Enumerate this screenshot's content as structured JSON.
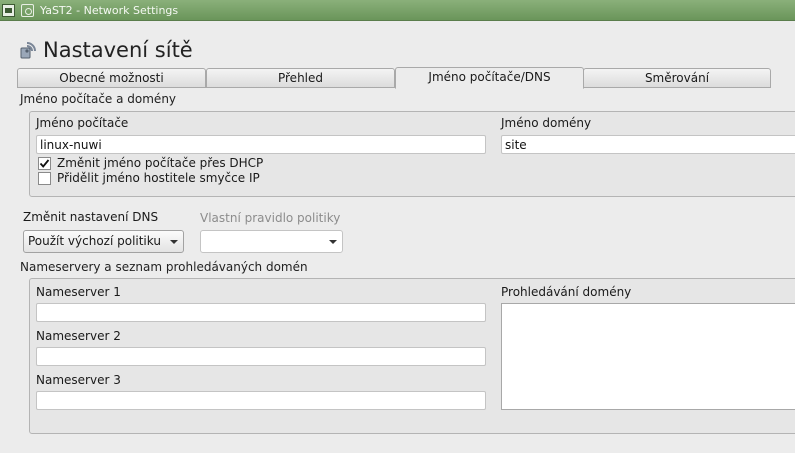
{
  "window": {
    "title": "YaST2 - Network Settings"
  },
  "page": {
    "title": "Nastavení sítě"
  },
  "tabs": [
    {
      "label": "Obecné možnosti"
    },
    {
      "label": "Přehled"
    },
    {
      "label": "Jméno počítače/DNS"
    },
    {
      "label": "Směrování"
    }
  ],
  "hostname_section": {
    "label": "Jméno počítače a domény",
    "hostname_label": "Jméno počítače",
    "hostname_value": "linux-nuwi",
    "domain_label": "Jméno domény",
    "domain_value": "site",
    "dhcp_checkbox": {
      "label": "Změnit jméno počítače přes DHCP",
      "checked": true
    },
    "loopback_checkbox": {
      "label": "Přidělit jméno hostitele smyčce IP",
      "checked": false
    }
  },
  "dns": {
    "mode_label": "Změnit nastavení DNS",
    "mode_value": "Použít výchozí politiku",
    "policy_label": "Vlastní pravidlo politiky",
    "policy_value": ""
  },
  "nameserver_section": {
    "label": "Nameservery a seznam prohledávaných domén",
    "ns1_label": "Nameserver 1",
    "ns1_value": "",
    "ns2_label": "Nameserver 2",
    "ns2_value": "",
    "ns3_label": "Nameserver 3",
    "ns3_value": "",
    "search_label": "Prohledávání domény",
    "search_value": ""
  }
}
